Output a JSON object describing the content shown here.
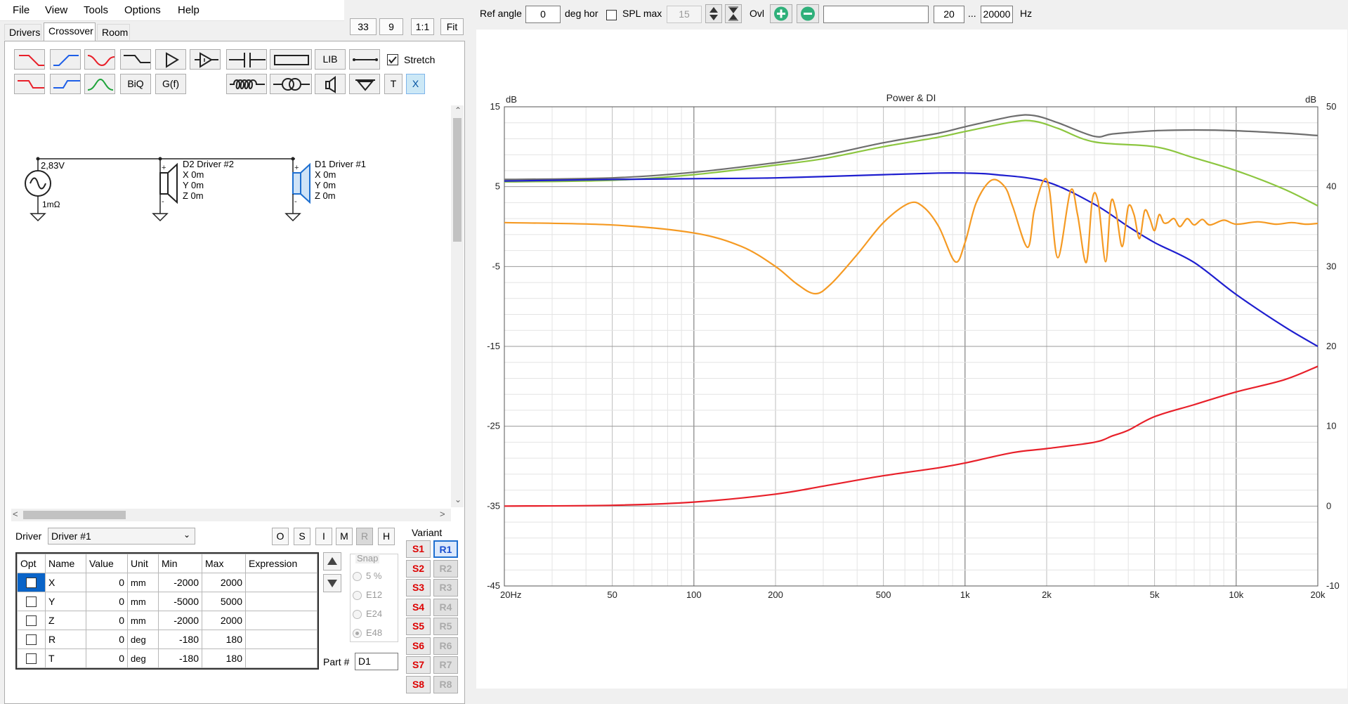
{
  "menu": [
    "File",
    "View",
    "Tools",
    "Options",
    "Help"
  ],
  "tabs": [
    "Drivers",
    "Crossover",
    "Room"
  ],
  "zoom": {
    "a": "33",
    "b": "9",
    "one_to_one": "1:1",
    "fit": "Fit"
  },
  "toolbar": {
    "lib": "LIB",
    "stretch": "Stretch",
    "biq": "BiQ",
    "gf": "G(f)",
    "t": "T",
    "x": "X"
  },
  "schematic": {
    "source_voltage": "2,83V",
    "source_resistance": "1mΩ",
    "driver2": {
      "title": "D2 Driver #2",
      "x": "X 0m",
      "y": "Y 0m",
      "z": "Z 0m"
    },
    "driver1": {
      "title": "D1 Driver #1",
      "x": "X 0m",
      "y": "Y 0m",
      "z": "Z 0m"
    }
  },
  "driver_panel": {
    "label": "Driver",
    "selected": "Driver #1",
    "buttons": [
      "O",
      "S",
      "I",
      "M",
      "R",
      "H"
    ],
    "columns": [
      "Opt",
      "Name",
      "Value",
      "Unit",
      "Min",
      "Max",
      "Expression"
    ],
    "rows": [
      {
        "name": "X",
        "value": "0",
        "unit": "mm",
        "min": "-2000",
        "max": "2000",
        "expr": ""
      },
      {
        "name": "Y",
        "value": "0",
        "unit": "mm",
        "min": "-5000",
        "max": "5000",
        "expr": ""
      },
      {
        "name": "Z",
        "value": "0",
        "unit": "mm",
        "min": "-2000",
        "max": "2000",
        "expr": ""
      },
      {
        "name": "R",
        "value": "0",
        "unit": "deg",
        "min": "-180",
        "max": "180",
        "expr": ""
      },
      {
        "name": "T",
        "value": "0",
        "unit": "deg",
        "min": "-180",
        "max": "180",
        "expr": ""
      }
    ],
    "snap": {
      "label": "Snap",
      "options": [
        "5 %",
        "E12",
        "E24",
        "E48"
      ],
      "selected": "E48"
    },
    "part_label": "Part #",
    "part_value": "D1"
  },
  "variant": {
    "label": "Variant",
    "s": [
      "S1",
      "S2",
      "S3",
      "S4",
      "S5",
      "S6",
      "S7",
      "S8"
    ],
    "r": [
      "R1",
      "R2",
      "R3",
      "R4",
      "R5",
      "R6",
      "R7",
      "R8"
    ],
    "active_r": "R1"
  },
  "top_bar": {
    "ref_angle_label": "Ref angle",
    "ref_angle": "0",
    "deg_hor": "deg hor",
    "spl_max_label": "SPL max",
    "spl_max": "15",
    "ovl": "Ovl",
    "search": "",
    "freq_from": "20",
    "dots": "...",
    "freq_to": "20000",
    "hz": "Hz"
  },
  "colors": {
    "red": "#e8202a",
    "blue": "#1e1ecf",
    "orange": "#f59a23",
    "green": "#8cc63f",
    "gray": "#6e6e6e",
    "accent": "#1f6fd1"
  },
  "chart_data": {
    "type": "line",
    "title": "Power & DI",
    "ylabel_left": "dB",
    "ylabel_right": "dB",
    "xscale": "log",
    "xlim": [
      20,
      20000
    ],
    "ylim_left": [
      -45,
      15
    ],
    "ylim_right": [
      -10,
      50
    ],
    "x_tick_labels": [
      "20Hz",
      "50",
      "100",
      "200",
      "500",
      "1k",
      "2k",
      "5k",
      "10k",
      "20k"
    ],
    "x_tick_values": [
      20,
      50,
      100,
      200,
      500,
      1000,
      2000,
      5000,
      10000,
      20000
    ],
    "y_left_ticks": [
      15,
      5,
      -5,
      -15,
      -25,
      -35,
      -45
    ],
    "y_right_ticks": [
      50,
      40,
      30,
      20,
      10,
      0,
      -10
    ],
    "grid": true,
    "series": [
      {
        "color": "#6e6e6e",
        "axis": "left",
        "x": [
          20,
          50,
          100,
          200,
          300,
          500,
          800,
          1000,
          1500,
          1800,
          2200,
          3000,
          3500,
          5000,
          7000,
          10000,
          15000,
          20000
        ],
        "y": [
          5.9,
          6.1,
          6.8,
          8.0,
          8.9,
          10.5,
          11.7,
          12.5,
          13.8,
          13.9,
          13.0,
          11.3,
          11.6,
          12.0,
          12.1,
          12.0,
          11.7,
          11.4
        ]
      },
      {
        "color": "#8cc63f",
        "axis": "left",
        "x": [
          20,
          50,
          100,
          200,
          300,
          500,
          800,
          1000,
          1500,
          1800,
          2200,
          3000,
          5000,
          7000,
          10000,
          15000,
          20000
        ],
        "y": [
          5.6,
          5.8,
          6.5,
          7.7,
          8.5,
          10.0,
          11.2,
          11.9,
          13.1,
          13.2,
          12.3,
          10.6,
          10.0,
          8.6,
          7.0,
          4.7,
          2.6
        ]
      },
      {
        "color": "#1e1ecf",
        "axis": "left",
        "x": [
          20,
          50,
          100,
          200,
          500,
          800,
          1000,
          1300,
          2000,
          3000,
          4000,
          5000,
          7000,
          10000,
          15000,
          20000
        ],
        "y": [
          5.7,
          5.9,
          6.0,
          6.1,
          6.5,
          6.7,
          6.7,
          6.5,
          5.6,
          2.8,
          0.0,
          -2.0,
          -4.5,
          -8.5,
          -12.5,
          -15.0
        ]
      },
      {
        "color": "#e8202a",
        "axis": "left",
        "x": [
          20,
          50,
          100,
          200,
          300,
          500,
          800,
          1000,
          1500,
          2000,
          3000,
          3500,
          4000,
          5000,
          7000,
          10000,
          15000,
          20000
        ],
        "y": [
          -35.0,
          -34.9,
          -34.5,
          -33.5,
          -32.5,
          -31.2,
          -30.2,
          -29.6,
          -28.3,
          -27.8,
          -27.0,
          -26.2,
          -25.5,
          -23.8,
          -22.3,
          -20.7,
          -19.2,
          -17.5
        ]
      },
      {
        "color": "#f59a23",
        "axis": "left",
        "x": [
          20,
          50,
          100,
          150,
          200,
          240,
          280,
          320,
          400,
          500,
          620,
          700,
          800,
          920,
          1000,
          1100,
          1250,
          1400,
          1500,
          1700,
          1800,
          1950,
          2050,
          2200,
          2450,
          2600,
          2800,
          2950,
          3100,
          3300,
          3450,
          3600,
          3800,
          4000,
          4200,
          4400,
          4600,
          4800,
          5000,
          5200,
          5400,
          5600,
          5900,
          6200,
          6600,
          7000,
          7500,
          8000,
          9000,
          10000,
          12000,
          14000,
          16000,
          18000,
          20000
        ],
        "y": [
          0.5,
          0.2,
          -0.8,
          -2.5,
          -5.0,
          -7.2,
          -8.4,
          -7.2,
          -3.5,
          0.5,
          2.9,
          2.5,
          0.0,
          -4.4,
          -2.0,
          3.0,
          5.8,
          5.0,
          2.5,
          -2.6,
          2.0,
          5.8,
          4.5,
          -3.9,
          4.5,
          1.5,
          -4.5,
          3.5,
          3.0,
          -4.4,
          3.0,
          2.0,
          -2.5,
          2.5,
          1.5,
          -1.5,
          2.0,
          1.0,
          -0.5,
          1.5,
          0.5,
          0.5,
          1.0,
          0.0,
          1.0,
          0.2,
          0.9,
          0.2,
          0.8,
          0.3,
          0.6,
          0.3,
          0.5,
          0.3,
          0.4
        ]
      }
    ]
  }
}
